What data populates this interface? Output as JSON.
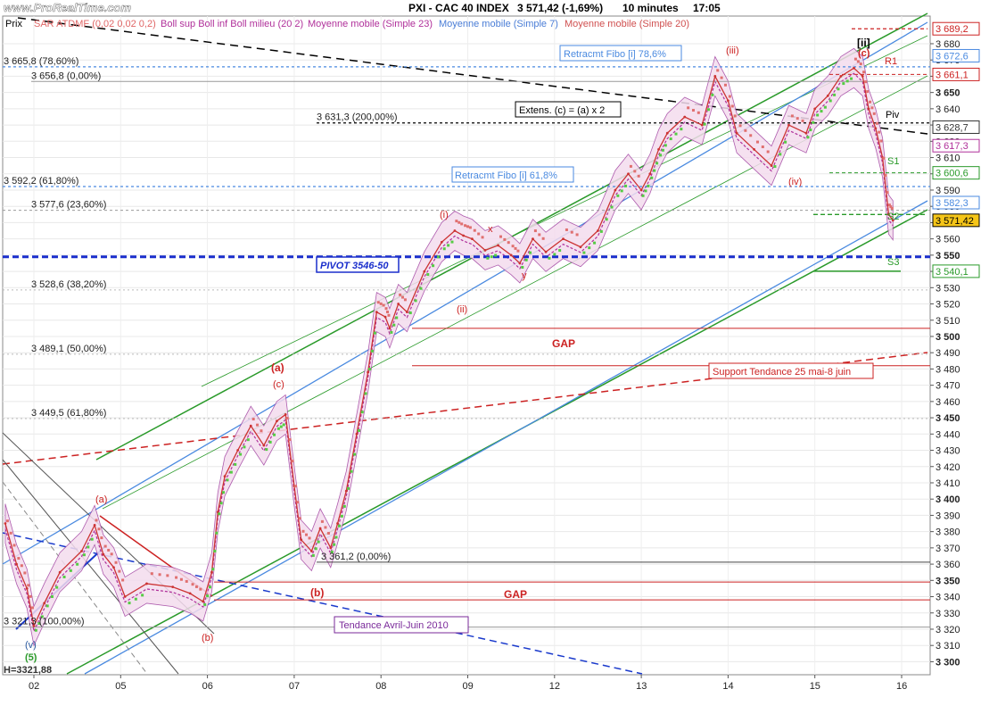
{
  "header": {
    "site": "www.ProRealTime.com",
    "title": "PXI - CAC 40 INDEX",
    "quote": "3 571,42 (-1,69%)",
    "interval": "10 minutes",
    "time": "17:05"
  },
  "legend": {
    "price": "Prix",
    "items": [
      {
        "label": "SAR ATDMF (0,02 0,02 0,2)",
        "color": "#e06666"
      },
      {
        "label": "Boll sup Boll inf Boll milieu (20 2)",
        "color": "#b0309a"
      },
      {
        "label": "Moyenne mobile (Simple 23)",
        "color": "#b0309a"
      },
      {
        "label": "Moyenne mobile (Simple 7)",
        "color": "#4a7dd6"
      },
      {
        "label": "Moyenne mobile (Simple 20)",
        "color": "#d05050"
      }
    ]
  },
  "colors": {
    "price": "#cc3333",
    "sar_up": "#55cc44",
    "sar_down": "#e07070",
    "band_fill": "#f4dcee",
    "band_line": "#a040a0",
    "channel_green": "#2a9a2a",
    "channel_blue": "#4a8ae0",
    "pivot": "#1a2ecc",
    "gap": "#cc2222",
    "last_price_bg": "#f5c518"
  },
  "chart_data": {
    "type": "line",
    "title": "PXI - CAC 40 INDEX",
    "interval": "10 minutes",
    "xlabel": "",
    "ylabel": "",
    "ylim": [
      3292,
      3697
    ],
    "yticks": [
      3300,
      3310,
      3320,
      3330,
      3340,
      3350,
      3360,
      3370,
      3380,
      3390,
      3400,
      3410,
      3420,
      3430,
      3440,
      3450,
      3460,
      3470,
      3480,
      3490,
      3500,
      3510,
      3520,
      3530,
      3540,
      3550,
      3560,
      3570,
      3580,
      3590,
      3600,
      3610,
      3620,
      3630,
      3640,
      3650,
      3660,
      3670,
      3680
    ],
    "major_yticks": [
      3300,
      3350,
      3400,
      3450,
      3500,
      3550,
      3600,
      3650
    ],
    "ytick_labels": [
      "3 300",
      "3 310",
      "3 320",
      "3 330",
      "3 340",
      "3 350",
      "3 360",
      "3 370",
      "3 380",
      "3 390",
      "3 400",
      "3 410",
      "3 420",
      "3 430",
      "3 440",
      "3 450",
      "3 460",
      "3 470",
      "3 480",
      "3 490",
      "3 500",
      "3 510",
      "3 520",
      "3 530",
      "3 540",
      "3 550",
      "3 560",
      "3 570",
      "3 580",
      "3 590",
      "3 600",
      "3 610",
      "3 620",
      "3 630",
      "3 640",
      "3 650",
      "3 660",
      "3 670",
      "3 680"
    ],
    "xlim": [
      0,
      10.3
    ],
    "xticks": [
      {
        "x": 0,
        "label": "02"
      },
      {
        "x": 1,
        "label": "05"
      },
      {
        "x": 2,
        "label": "06"
      },
      {
        "x": 3,
        "label": "07"
      },
      {
        "x": 4,
        "label": "08"
      },
      {
        "x": 5,
        "label": "09"
      },
      {
        "x": 6,
        "label": "12"
      },
      {
        "x": 7,
        "label": "13"
      },
      {
        "x": 8,
        "label": "14"
      },
      {
        "x": 9,
        "label": "15"
      },
      {
        "x": 10,
        "label": "16"
      }
    ],
    "series": [
      {
        "name": "Prix",
        "x": [
          -0.33,
          -0.2,
          -0.08,
          0.0,
          0.12,
          0.3,
          0.55,
          0.7,
          0.8,
          0.92,
          1.05,
          1.3,
          1.6,
          1.8,
          1.95,
          2.05,
          2.12,
          2.2,
          2.35,
          2.5,
          2.65,
          2.8,
          2.9,
          3.0,
          3.08,
          3.2,
          3.3,
          3.42,
          3.5,
          3.6,
          3.72,
          3.85,
          3.95,
          4.05,
          4.1,
          4.2,
          4.3,
          4.5,
          4.7,
          4.85,
          4.95,
          5.05,
          5.2,
          5.35,
          5.5,
          5.6,
          5.75,
          5.9,
          6.1,
          6.3,
          6.5,
          6.7,
          6.85,
          7.0,
          7.1,
          7.2,
          7.3,
          7.5,
          7.7,
          7.85,
          8.0,
          8.1,
          8.3,
          8.5,
          8.7,
          8.9,
          9.0,
          9.15,
          9.3,
          9.45,
          9.55,
          9.62,
          9.7,
          9.78,
          9.85,
          9.9
        ],
        "values": [
          3385,
          3360,
          3345,
          3322,
          3336,
          3355,
          3368,
          3384,
          3366,
          3358,
          3340,
          3348,
          3346,
          3342,
          3337,
          3355,
          3392,
          3414,
          3430,
          3445,
          3433,
          3448,
          3452,
          3408,
          3375,
          3368,
          3382,
          3370,
          3385,
          3405,
          3440,
          3478,
          3515,
          3512,
          3505,
          3520,
          3515,
          3540,
          3558,
          3565,
          3562,
          3560,
          3553,
          3556,
          3550,
          3545,
          3560,
          3552,
          3560,
          3555,
          3565,
          3590,
          3600,
          3590,
          3600,
          3615,
          3625,
          3635,
          3630,
          3660,
          3645,
          3625,
          3615,
          3605,
          3630,
          3625,
          3640,
          3648,
          3660,
          3665,
          3660,
          3640,
          3628,
          3610,
          3575,
          3571.42
        ]
      }
    ],
    "annotations": {
      "fibo_left": [
        {
          "label": "3 665,8 (78,60%)",
          "y": 3665.8
        },
        {
          "label": "3 656,8 (0,00%)",
          "y": 3656.8
        },
        {
          "label": "3 631,3 (200,00%)",
          "y": 3631.3
        },
        {
          "label": "3 592,2 (61,80%)",
          "y": 3592.2
        },
        {
          "label": "3 577,6 (23,60%)",
          "y": 3577.6
        },
        {
          "label": "3 528,6 (38,20%)",
          "y": 3528.6
        },
        {
          "label": "3 489,1 (50,00%)",
          "y": 3489.1
        },
        {
          "label": "3 449,5 (61,80%)",
          "y": 3449.5
        },
        {
          "label": "3 361,2 (0,00%)",
          "y": 3361.2
        },
        {
          "label": "3 321,3 (100,00%)",
          "y": 3321.3
        }
      ],
      "boxes": [
        {
          "label": "Retracmt Fibo [i] 78,6%",
          "color": "#4a8ae0"
        },
        {
          "label": "Extens. (c) = (a) x 2",
          "color": "#000000"
        },
        {
          "label": "Retracmt Fibo [i] 61,8%",
          "color": "#4a8ae0"
        },
        {
          "label": "PIVOT 3546-50",
          "color": "#1a2ecc"
        },
        {
          "label": "Support Tendance 25 mai-8 juin",
          "color": "#cc2222"
        },
        {
          "label": "Tendance Avril-Juin 2010",
          "color": "#7a2a9a"
        }
      ],
      "gaps": [
        "GAP",
        "GAP"
      ],
      "right_levels": [
        {
          "label": "3 689,2",
          "y": 3689.2,
          "color": "#cc2222"
        },
        {
          "label": "3 672,6",
          "y": 3672.6,
          "color": "#4a8ae0"
        },
        {
          "label": "3 661,1",
          "y": 3661.1,
          "color": "#cc2222"
        },
        {
          "label": "3 628,7",
          "y": 3628.7,
          "color": "#333333"
        },
        {
          "label": "3 617,3",
          "y": 3617.3,
          "color": "#b0309a"
        },
        {
          "label": "3 600,6",
          "y": 3600.6,
          "color": "#2a9a2a"
        },
        {
          "label": "3 582,3",
          "y": 3582.3,
          "color": "#4a8ae0"
        },
        {
          "label": "3 571,42",
          "y": 3571.42,
          "color": "#000000"
        },
        {
          "label": "3 540,1",
          "y": 3540.1,
          "color": "#2a9a2a"
        }
      ],
      "side_marks": [
        "R1",
        "Piv",
        "S1",
        "S2",
        "S3"
      ],
      "wave_labels": [
        "(iii)",
        "[ii]",
        "(c)",
        "(iv)",
        "(i)",
        "(ii)",
        "(a)",
        "(b)",
        "(c)",
        "(v)",
        "(5)",
        "(a)",
        "(b)",
        "x",
        "y"
      ],
      "bottom_left": "H=3321,88"
    }
  }
}
